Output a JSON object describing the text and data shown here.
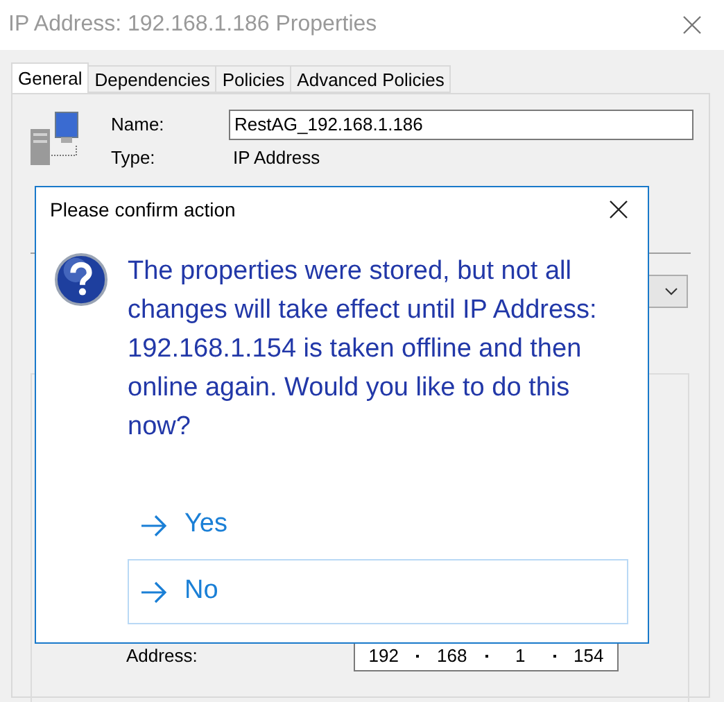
{
  "window": {
    "title": "IP Address: 192.168.1.186 Properties"
  },
  "tabs": [
    {
      "label": "General",
      "selected": true
    },
    {
      "label": "Dependencies",
      "selected": false
    },
    {
      "label": "Policies",
      "selected": false
    },
    {
      "label": "Advanced Policies",
      "selected": false
    }
  ],
  "general": {
    "name_label": "Name:",
    "name_value": "RestAG_192.168.1.186",
    "type_label": "Type:",
    "type_value": "IP Address",
    "address_label": "Address:",
    "address_octets": [
      "192",
      "168",
      "1",
      "154"
    ]
  },
  "dialog": {
    "title": "Please confirm action",
    "message": "The properties were stored, but not all changes will take effect until IP Address: 192.168.1.154 is taken offline and then online again. Would you like to do this now?",
    "options": [
      {
        "label": "Yes",
        "focused": false
      },
      {
        "label": "No",
        "focused": true
      }
    ]
  }
}
